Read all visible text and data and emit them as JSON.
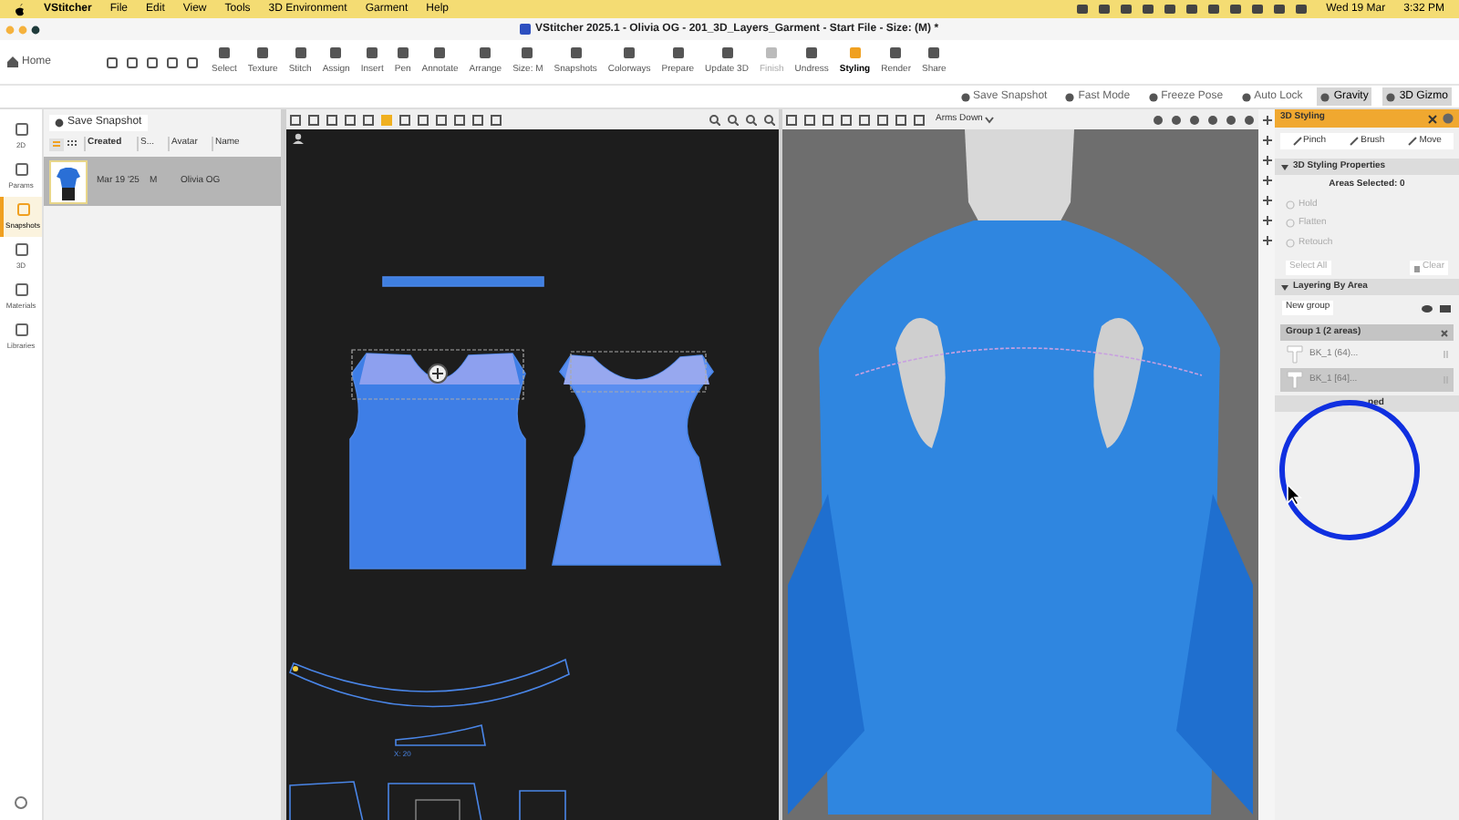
{
  "menu_bar": {
    "app": "VStitcher",
    "items": [
      "File",
      "Edit",
      "View",
      "Tools",
      "3D Environment",
      "Garment",
      "Help"
    ],
    "date": "Wed 19 Mar",
    "time": "3:32 PM"
  },
  "window": {
    "title": "VStitcher 2025.1 - Olivia OG - 201_3D_Layers_Garment - Start File - Size: (M) *"
  },
  "toolbar": {
    "home": "Home",
    "tools": [
      {
        "label": "Select",
        "selected": false,
        "disabled": false
      },
      {
        "label": "Texture",
        "selected": false,
        "disabled": false
      },
      {
        "label": "Stitch",
        "selected": false,
        "disabled": false
      },
      {
        "label": "Assign",
        "selected": false,
        "disabled": false
      },
      {
        "label": "Insert",
        "selected": false,
        "disabled": false
      },
      {
        "label": "Pen",
        "selected": false,
        "disabled": false
      },
      {
        "label": "Annotate",
        "selected": false,
        "disabled": false
      },
      {
        "label": "Arrange",
        "selected": false,
        "disabled": false
      },
      {
        "label": "Size: M",
        "selected": false,
        "disabled": false
      },
      {
        "label": "Snapshots",
        "selected": false,
        "disabled": false
      },
      {
        "label": "Colorways",
        "selected": false,
        "disabled": false
      },
      {
        "label": "Prepare",
        "selected": false,
        "disabled": false
      },
      {
        "label": "Update 3D",
        "selected": false,
        "disabled": false
      },
      {
        "label": "Finish",
        "selected": false,
        "disabled": true
      },
      {
        "label": "Undress",
        "selected": false,
        "disabled": false
      },
      {
        "label": "Styling",
        "selected": true,
        "disabled": false
      },
      {
        "label": "Render",
        "selected": false,
        "disabled": false
      },
      {
        "label": "Share",
        "selected": false,
        "disabled": false
      }
    ]
  },
  "sub_toolbar": [
    {
      "label": "Save Snapshot",
      "on": false
    },
    {
      "label": "Fast Mode",
      "on": false
    },
    {
      "label": "Freeze Pose",
      "on": false
    },
    {
      "label": "Auto Lock",
      "on": false
    },
    {
      "label": "Gravity",
      "on": true
    },
    {
      "label": "3D Gizmo",
      "on": true
    }
  ],
  "left_rail": [
    {
      "label": "2D",
      "selected": false
    },
    {
      "label": "Params",
      "selected": false
    },
    {
      "label": "Snapshots",
      "selected": true
    },
    {
      "label": "3D",
      "selected": false
    },
    {
      "label": "Materials",
      "selected": false
    },
    {
      "label": "Libraries",
      "selected": false
    }
  ],
  "snapshots": {
    "save_button": "Save Snapshot",
    "columns": [
      "Created",
      "S...",
      "Avatar",
      "Name"
    ],
    "rows": [
      {
        "created": "Mar 19 '25",
        "size": "M",
        "avatar": "Olivia OG",
        "selected": true
      }
    ]
  },
  "view_2d": {
    "measure_label": "X: 20"
  },
  "view_3d": {
    "pose": "Arms Down"
  },
  "styling_panel": {
    "title": "3D Styling",
    "tools": [
      "Pinch",
      "Brush",
      "Move"
    ],
    "properties": {
      "title": "3D Styling Properties",
      "areas_selected": "Areas Selected: 0",
      "options": [
        {
          "label": "Hold",
          "selected": false
        },
        {
          "label": "Flatten",
          "selected": false
        },
        {
          "label": "Retouch",
          "selected": false
        }
      ],
      "select_all": "Select All",
      "clear": "Clear"
    },
    "layering": {
      "title": "Layering By Area",
      "new_group": "New group",
      "group": "Group 1 (2 areas)",
      "items": [
        {
          "label": "BK_1 (64)...",
          "selected": false
        },
        {
          "label": "BK_1 [64]...",
          "selected": true
        }
      ],
      "ungrouped": "ped"
    }
  }
}
